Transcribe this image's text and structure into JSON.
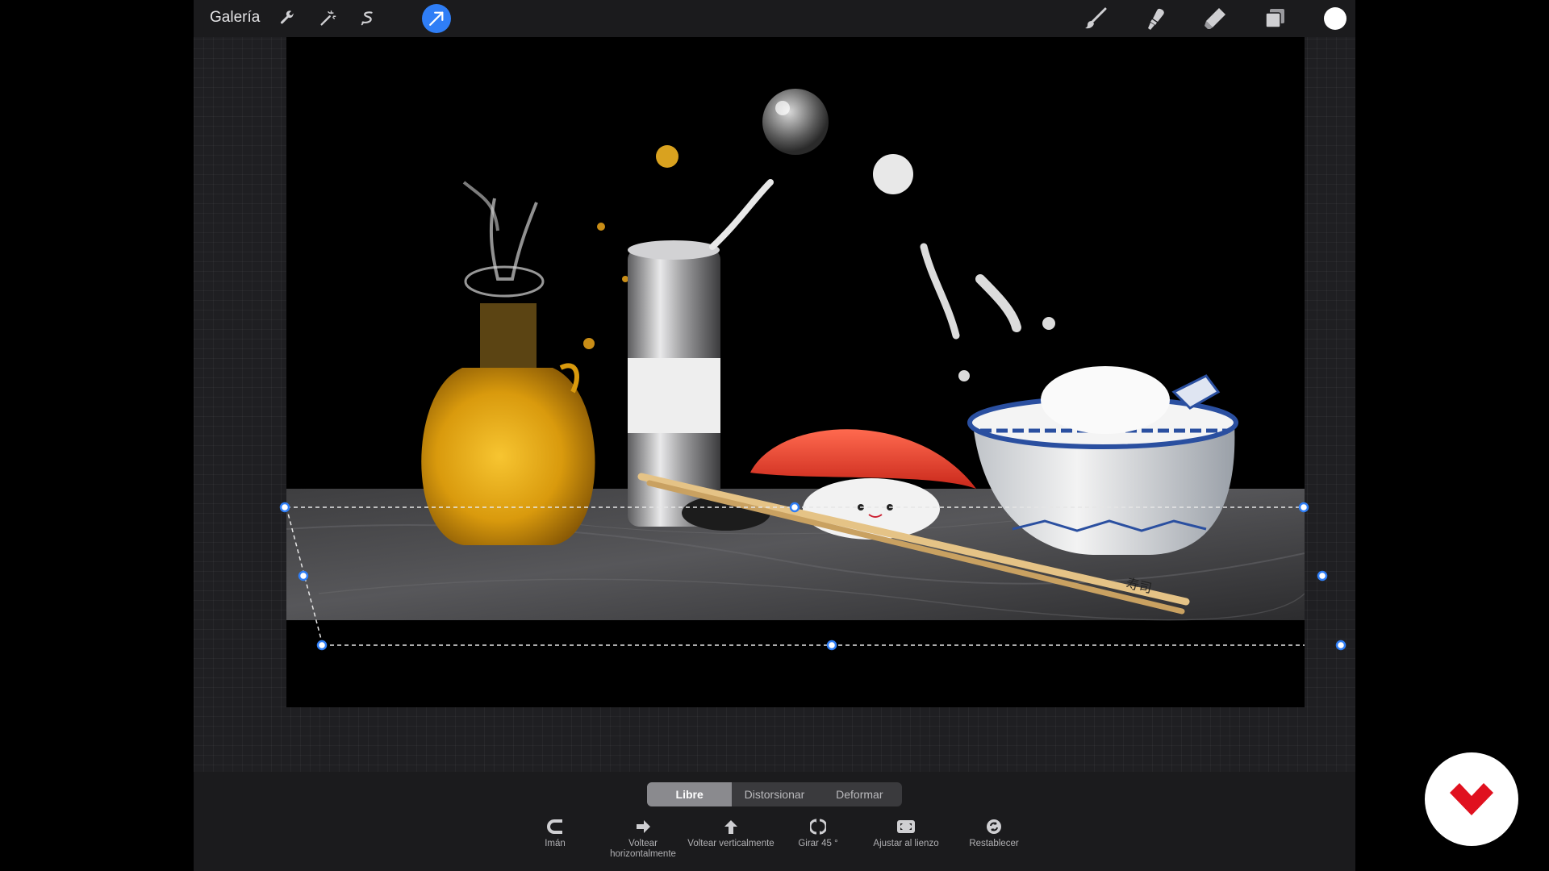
{
  "topbar": {
    "gallery_label": "Galería",
    "tools_left": [
      {
        "icon": "wrench-icon"
      },
      {
        "icon": "magic-wand-icon"
      },
      {
        "icon": "selection-s-icon"
      },
      {
        "icon": "transform-arrow-icon",
        "active": true
      }
    ],
    "tools_right": [
      {
        "icon": "brush-icon"
      },
      {
        "icon": "smudge-icon"
      },
      {
        "icon": "eraser-icon"
      },
      {
        "icon": "layers-icon"
      }
    ],
    "current_color": "#ffffff"
  },
  "transform": {
    "modes": [
      "Libre",
      "Distorsionar",
      "Deformar"
    ],
    "active_mode": "Libre",
    "actions": [
      {
        "icon": "magnet-icon",
        "label": "Imán"
      },
      {
        "icon": "arrow-right-icon",
        "label": "Voltear horizontalmente"
      },
      {
        "icon": "arrow-up-icon",
        "label": "Voltear verticalmente"
      },
      {
        "icon": "rotate-icon",
        "label": "Girar 45 °"
      },
      {
        "icon": "fit-canvas-icon",
        "label": "Ajustar al lienzo"
      },
      {
        "icon": "reset-icon",
        "label": "Restablecer"
      }
    ]
  },
  "colors": {
    "accent": "#2f7ef6",
    "toolbar_bg": "#1b1b1d",
    "workspace_bg": "#1f1f22",
    "logo_red": "#e0111f"
  },
  "artwork": {
    "subject": "still life with oil cruet, salt shaker, sushi, chopsticks and rice bowl",
    "chopsticks_text": "寿司"
  }
}
